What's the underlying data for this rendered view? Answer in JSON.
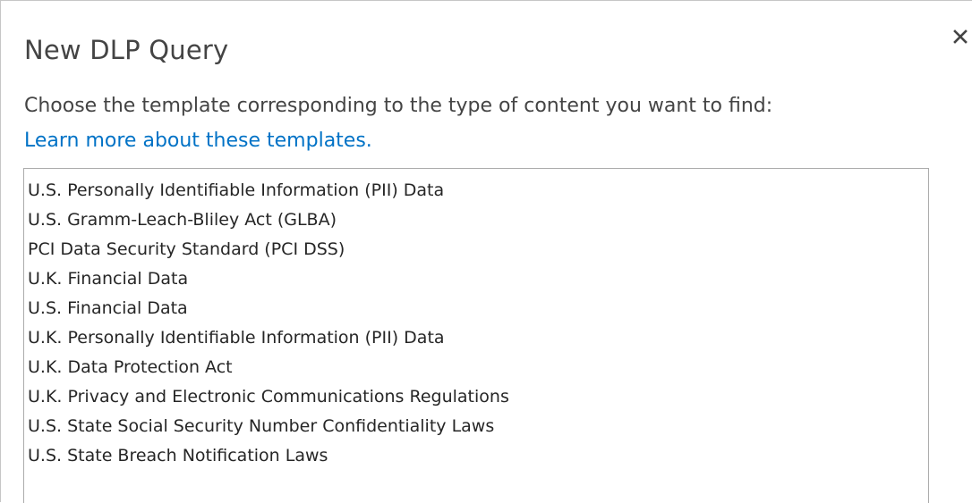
{
  "dialog": {
    "title": "New DLP Query",
    "close_icon": "close-icon",
    "instruction": "Choose the template corresponding to the type of content you want to find:",
    "learn_more_link": "Learn more about these templates."
  },
  "templates": {
    "items": [
      "U.S. Personally Identifiable Information (PII) Data",
      "U.S. Gramm-Leach-Bliley Act (GLBA)",
      "PCI Data Security Standard (PCI DSS)",
      "U.K. Financial Data",
      "U.S. Financial Data",
      "U.K. Personally Identifiable Information (PII) Data",
      "U.K. Data Protection Act",
      "U.K. Privacy and Electronic Communications Regulations",
      "U.S. State Social Security Number Confidentiality Laws",
      "U.S. State Breach Notification Laws"
    ]
  },
  "colors": {
    "text": "#444444",
    "link": "#0072c6",
    "list_text": "#262626",
    "border": "#ababab"
  }
}
